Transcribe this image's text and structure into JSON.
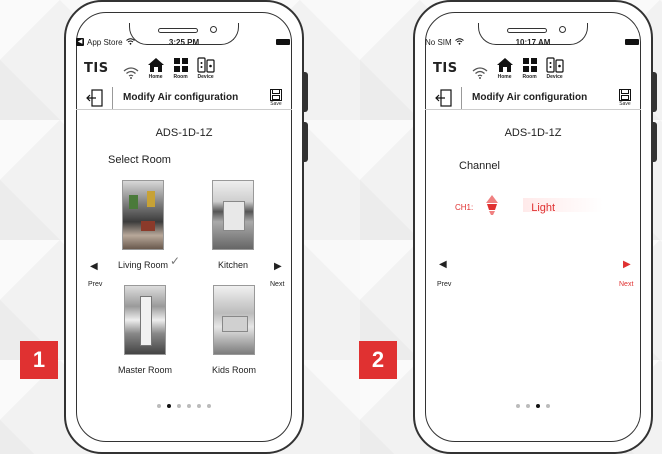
{
  "accent_color": "#e03131",
  "screen1": {
    "badge": "1",
    "status": {
      "carrier": "App Store",
      "time": "3:25 PM"
    },
    "brand": "TIS",
    "top_icons": {
      "home": "Home",
      "room": "Room",
      "device": "Device"
    },
    "nav": {
      "title": "Modify Air configuration",
      "save": "Save"
    },
    "device_id": "ADS-1D-1Z",
    "section_title": "Select Room",
    "rooms": [
      {
        "name": "Living Room",
        "selected": true
      },
      {
        "name": "Kitchen",
        "selected": false
      },
      {
        "name": "Master Room",
        "selected": false
      },
      {
        "name": "Kids Room",
        "selected": false
      }
    ],
    "prev_label": "Prev",
    "next_label": "Next",
    "page_count": 6,
    "active_page": 2
  },
  "screen2": {
    "badge": "2",
    "status": {
      "carrier": "No SIM",
      "time": "10:17 AM"
    },
    "brand": "TIS",
    "top_icons": {
      "home": "Home",
      "room": "Room",
      "device": "Device"
    },
    "nav": {
      "title": "Modify Air configuration",
      "save": "Save"
    },
    "device_id": "ADS-1D-1Z",
    "section_title": "Channel",
    "channel": {
      "name": "CH1:",
      "value": "Light"
    },
    "prev_label": "Prev",
    "next_label": "Next",
    "page_count": 4,
    "active_page": 3
  }
}
